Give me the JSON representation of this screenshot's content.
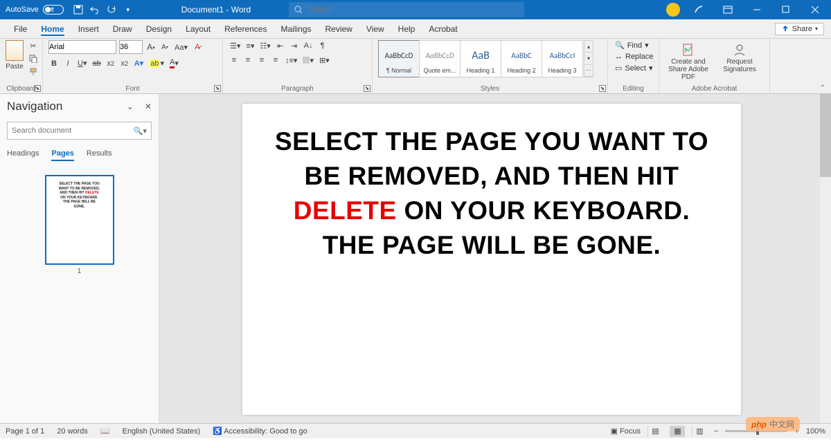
{
  "titlebar": {
    "autosave_label": "AutoSave",
    "autosave_state": "Off",
    "document_title": "Document1 - Word",
    "search_placeholder": "Search"
  },
  "ribbon": {
    "tabs": [
      "File",
      "Home",
      "Insert",
      "Draw",
      "Design",
      "Layout",
      "References",
      "Mailings",
      "Review",
      "View",
      "Help",
      "Acrobat"
    ],
    "active_tab": "Home",
    "share": "Share",
    "groups": {
      "clipboard": {
        "label": "Clipboard",
        "paste": "Paste"
      },
      "font": {
        "label": "Font",
        "name": "Arial",
        "size": "36"
      },
      "paragraph": {
        "label": "Paragraph"
      },
      "styles": {
        "label": "Styles",
        "items": [
          {
            "preview": "AaBbCcD",
            "name": "¶ Normal"
          },
          {
            "preview": "AaBbCcD",
            "name": "Quote em..."
          },
          {
            "preview": "AaB",
            "name": "Heading 1"
          },
          {
            "preview": "AaBbC",
            "name": "Heading 2"
          },
          {
            "preview": "AaBbCcI",
            "name": "Heading 3"
          }
        ]
      },
      "editing": {
        "label": "Editing",
        "find": "Find",
        "replace": "Replace",
        "select": "Select"
      },
      "adobe": {
        "label": "Adobe Acrobat",
        "create": "Create and Share Adobe PDF",
        "request": "Request Signatures"
      }
    }
  },
  "nav": {
    "title": "Navigation",
    "search_placeholder": "Search document",
    "tabs": [
      "Headings",
      "Pages",
      "Results"
    ],
    "thumb_text": {
      "l1": "SELECT THE PAGE YOU",
      "l2": "WANT TO BE REMOVED,",
      "l3": "AND THEN HIT ",
      "l3r": "DELETE",
      "l4": "ON YOUR KEYBOARD.",
      "l5": "THE PAGE WILL BE",
      "l6": "GONE."
    },
    "thumb_num": "1"
  },
  "document": {
    "line1": "SELECT THE PAGE YOU WANT TO BE REMOVED, AND THEN HIT ",
    "delete": "DELETE",
    "line2": " ON YOUR KEYBOARD. THE PAGE WILL BE GONE."
  },
  "status": {
    "page": "Page 1 of 1",
    "words": "20 words",
    "language": "English (United States)",
    "accessibility": "Accessibility: Good to go",
    "focus": "Focus",
    "zoom": "100%"
  },
  "watermark": {
    "brand": "php",
    "suffix": "中文网"
  }
}
